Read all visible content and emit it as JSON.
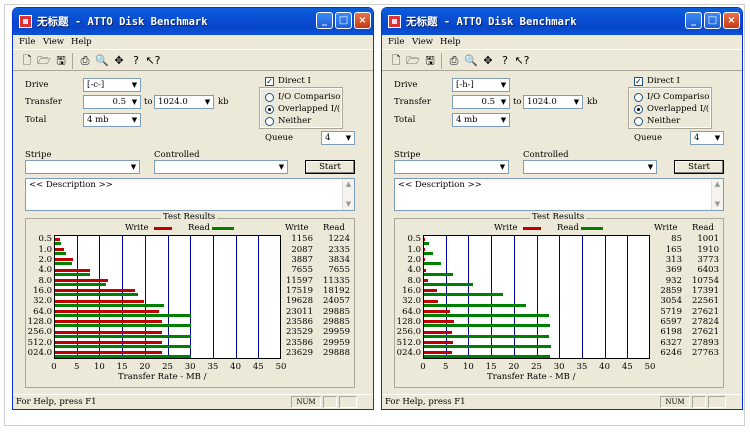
{
  "windows": [
    {
      "title": "无标题 - ATTO Disk Benchmark",
      "menu": [
        "File",
        "View",
        "Help"
      ],
      "drive_label": "Drive",
      "drive_value": "[-c-]",
      "transfer_label": "Transfer",
      "transfer_from": "0.5",
      "to_label": "to",
      "transfer_to": "1024.0",
      "kb_label": "kb",
      "total_label": "Total",
      "total_value": "4 mb",
      "direct_io_label": "Direct I",
      "direct_io_checked": true,
      "radio_io_comparison": "I/O Comparisor",
      "radio_overlapped": "Overlapped I/(",
      "radio_neither": "Neither",
      "queue_label": "Queue",
      "queue_value": "4",
      "stripe_label": "Stripe",
      "controlled_label": "Controlled",
      "start_label": "Start",
      "description": "<< Description >>",
      "results_title": "Test Results",
      "write_legend": "Write",
      "read_legend": "Read",
      "write_header": "Write",
      "read_header": "Read",
      "xaxis_title": "Transfer Rate - MB /",
      "status_text": "For Help, press F1",
      "status_num": "NUM",
      "chart_data": {
        "type": "bar",
        "categories": [
          "0.5",
          "1.0",
          "2.0",
          "4.0",
          "8.0",
          "16.0",
          "32.0",
          "64.0",
          "128.0",
          "256.0",
          "512.0",
          "024.0"
        ],
        "series": [
          {
            "name": "Write",
            "values": [
              1156,
              2087,
              3887,
              7655,
              11597,
              17519,
              19628,
              23011,
              23586,
              23529,
              23586,
              23629
            ]
          },
          {
            "name": "Read",
            "values": [
              1224,
              2335,
              3834,
              7655,
              11335,
              18192,
              24057,
              29885,
              29885,
              29959,
              29959,
              29888
            ]
          }
        ],
        "write_values_text": [
          "1156",
          "2087",
          "3887",
          "7655",
          "11597",
          "17519",
          "19628",
          "23011",
          "23586",
          "23529",
          "23586",
          "23629"
        ],
        "read_values_text": [
          "1224",
          "2335",
          "3834",
          "7655",
          "11335",
          "18192",
          "24057",
          "29885",
          "29885",
          "29959",
          "29959",
          "29888"
        ],
        "x_ticks": [
          "0",
          "5",
          "10",
          "15",
          "20",
          "25",
          "30",
          "35",
          "40",
          "45",
          "50"
        ],
        "xlim": [
          0,
          50
        ],
        "xlabel": "Transfer Rate - MB /",
        "colors": {
          "write": "#c00000",
          "read": "#008000"
        }
      }
    },
    {
      "title": "无标题 - ATTO Disk Benchmark",
      "menu": [
        "File",
        "View",
        "Help"
      ],
      "drive_label": "Drive",
      "drive_value": "[-h-]",
      "transfer_label": "Transfer",
      "transfer_from": "0.5",
      "to_label": "to",
      "transfer_to": "1024.0",
      "kb_label": "kb",
      "total_label": "Total",
      "total_value": "4 mb",
      "direct_io_label": "Direct I",
      "direct_io_checked": true,
      "radio_io_comparison": "I/O Comparisor",
      "radio_overlapped": "Overlapped I/(",
      "radio_neither": "Neither",
      "queue_label": "Queue",
      "queue_value": "4",
      "stripe_label": "Stripe",
      "controlled_label": "Controlled",
      "start_label": "Start",
      "description": "<< Description >>",
      "results_title": "Test Results",
      "write_legend": "Write",
      "read_legend": "Read",
      "write_header": "Write",
      "read_header": "Read",
      "xaxis_title": "Transfer Rate - MB /",
      "status_text": "For Help, press F1",
      "status_num": "NUM",
      "chart_data": {
        "type": "bar",
        "categories": [
          "0.5",
          "1.0",
          "2.0",
          "4.0",
          "8.0",
          "16.0",
          "32.0",
          "64.0",
          "128.0",
          "256.0",
          "512.0",
          "024.0"
        ],
        "series": [
          {
            "name": "Write",
            "values": [
              85,
              165,
              313,
              369,
              932,
              2859,
              3054,
              5719,
              6597,
              6198,
              6327,
              6246
            ]
          },
          {
            "name": "Read",
            "values": [
              1001,
              1910,
              3773,
              6403,
              10754,
              17391,
              22561,
              27621,
              27824,
              27621,
              27893,
              27763
            ]
          }
        ],
        "write_values_text": [
          "85",
          "165",
          "313",
          "369",
          "932",
          "2859",
          "3054",
          "5719",
          "6597",
          "6198",
          "6327",
          "6246"
        ],
        "read_values_text": [
          "1001",
          "1910",
          "3773",
          "6403",
          "10754",
          "17391",
          "22561",
          "27621",
          "27824",
          "27621",
          "27893",
          "27763"
        ],
        "x_ticks": [
          "0",
          "5",
          "10",
          "15",
          "20",
          "25",
          "30",
          "35",
          "40",
          "45",
          "50"
        ],
        "xlim": [
          0,
          50
        ],
        "xlabel": "Transfer Rate - MB /",
        "colors": {
          "write": "#c00000",
          "read": "#008000"
        }
      }
    }
  ]
}
